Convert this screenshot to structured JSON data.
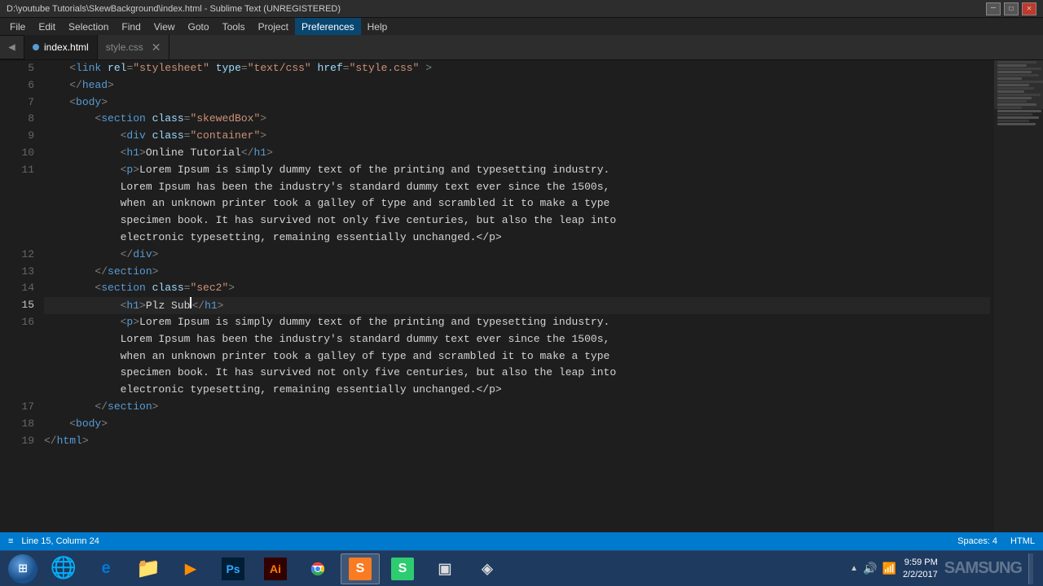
{
  "titleBar": {
    "text": "D:\\youtube Tutorials\\SkewBackground\\index.html - Sublime Text (UNREGISTERED)",
    "controls": [
      "—",
      "☐",
      "✕"
    ]
  },
  "menuBar": {
    "items": [
      "File",
      "Edit",
      "Selection",
      "Find",
      "View",
      "Goto",
      "Tools",
      "Project",
      "Preferences",
      "Help"
    ]
  },
  "tabs": [
    {
      "id": "index",
      "label": "index.html",
      "active": true,
      "modified": true
    },
    {
      "id": "style",
      "label": "style.css",
      "active": false,
      "modified": false,
      "closeable": true
    }
  ],
  "statusBar": {
    "line": "Line 15, Column 24",
    "spaces": "Spaces: 4",
    "encoding": "HTML"
  },
  "taskbar": {
    "apps": [
      {
        "name": "windows-start",
        "icon": "⊞"
      },
      {
        "name": "browser-ie",
        "icon": "🌐"
      },
      {
        "name": "browser-edge",
        "icon": "e"
      },
      {
        "name": "file-explorer",
        "icon": "📁"
      },
      {
        "name": "media-player",
        "icon": "▶"
      },
      {
        "name": "photoshop",
        "icon": "Ps"
      },
      {
        "name": "illustrator",
        "icon": "Ai"
      },
      {
        "name": "chrome",
        "icon": "◉"
      },
      {
        "name": "sublime-text",
        "icon": "S"
      },
      {
        "name": "app6",
        "icon": "S"
      },
      {
        "name": "app7",
        "icon": "▣"
      },
      {
        "name": "app8",
        "icon": "◈"
      }
    ],
    "clock": {
      "time": "9:59 PM",
      "date": "2/2/2017"
    }
  },
  "code": {
    "lines": [
      {
        "num": 5,
        "content": [
          {
            "t": "punct",
            "v": "    <"
          },
          {
            "t": "tag",
            "v": "link"
          },
          {
            "t": "attr",
            "v": " rel"
          },
          {
            "t": "punct",
            "v": "="
          },
          {
            "t": "str",
            "v": "\"stylesheet\""
          },
          {
            "t": "attr",
            "v": " type"
          },
          {
            "t": "punct",
            "v": "="
          },
          {
            "t": "str",
            "v": "\"text/css\""
          },
          {
            "t": "attr",
            "v": " href"
          },
          {
            "t": "punct",
            "v": "="
          },
          {
            "t": "str",
            "v": "\"style.css\""
          },
          {
            "t": "punct",
            "v": " >"
          }
        ]
      },
      {
        "num": 6,
        "content": [
          {
            "t": "punct",
            "v": "    </"
          },
          {
            "t": "tag",
            "v": "head"
          },
          {
            "t": "punct",
            "v": ">"
          }
        ]
      },
      {
        "num": 7,
        "content": [
          {
            "t": "punct",
            "v": "    <"
          },
          {
            "t": "tag",
            "v": "body"
          },
          {
            "t": "punct",
            "v": ">"
          }
        ]
      },
      {
        "num": 8,
        "content": [
          {
            "t": "punct",
            "v": "        <"
          },
          {
            "t": "tag",
            "v": "section"
          },
          {
            "t": "attr",
            "v": " class"
          },
          {
            "t": "punct",
            "v": "="
          },
          {
            "t": "str",
            "v": "\"skewedBox\""
          },
          {
            "t": "punct",
            "v": ">"
          }
        ]
      },
      {
        "num": 9,
        "content": [
          {
            "t": "punct",
            "v": "            <"
          },
          {
            "t": "tag",
            "v": "div"
          },
          {
            "t": "attr",
            "v": " class"
          },
          {
            "t": "punct",
            "v": "="
          },
          {
            "t": "str",
            "v": "\"container\""
          },
          {
            "t": "punct",
            "v": ">"
          }
        ]
      },
      {
        "num": 10,
        "content": [
          {
            "t": "punct",
            "v": "            <"
          },
          {
            "t": "tag",
            "v": "h1"
          },
          {
            "t": "punct",
            "v": ">"
          },
          {
            "t": "text",
            "v": "Online Tutorial"
          },
          {
            "t": "punct",
            "v": "</"
          },
          {
            "t": "tag",
            "v": "h1"
          },
          {
            "t": "punct",
            "v": ">"
          }
        ]
      },
      {
        "num": 11,
        "content": [
          {
            "t": "punct",
            "v": "            <"
          },
          {
            "t": "tag",
            "v": "p"
          },
          {
            "t": "punct",
            "v": ">"
          },
          {
            "t": "text",
            "v": "Lorem Ipsum is simply dummy text of the printing and typesetting industry."
          },
          {
            "t": "punct",
            "v": ""
          }
        ]
      },
      {
        "num": "",
        "content": [
          {
            "t": "text",
            "v": "            Lorem Ipsum has been the industry's standard dummy text ever since the 1500s,"
          }
        ]
      },
      {
        "num": "",
        "content": [
          {
            "t": "text",
            "v": "            when an unknown printer took a galley of type and scrambled it to make a type"
          }
        ]
      },
      {
        "num": "",
        "content": [
          {
            "t": "text",
            "v": "            specimen book. It has survived not only five centuries, but also the leap into"
          }
        ]
      },
      {
        "num": "",
        "content": [
          {
            "t": "text",
            "v": "            electronic typesetting, remaining essentially unchanged.</p>"
          }
        ]
      },
      {
        "num": 12,
        "content": [
          {
            "t": "punct",
            "v": "            </"
          },
          {
            "t": "tag",
            "v": "div"
          },
          {
            "t": "punct",
            "v": ">"
          }
        ]
      },
      {
        "num": 13,
        "content": [
          {
            "t": "punct",
            "v": "        </"
          },
          {
            "t": "tag",
            "v": "section"
          },
          {
            "t": "punct",
            "v": ">"
          }
        ]
      },
      {
        "num": 14,
        "content": [
          {
            "t": "punct",
            "v": "        <"
          },
          {
            "t": "tag",
            "v": "section"
          },
          {
            "t": "attr",
            "v": " class"
          },
          {
            "t": "punct",
            "v": "="
          },
          {
            "t": "str",
            "v": "\"sec2\""
          },
          {
            "t": "punct",
            "v": ">"
          }
        ]
      },
      {
        "num": 15,
        "content": [
          {
            "t": "punct",
            "v": "            <"
          },
          {
            "t": "tag",
            "v": "h1"
          },
          {
            "t": "punct",
            "v": ">"
          },
          {
            "t": "text",
            "v": "Plz Sub"
          },
          {
            "t": "cursor",
            "v": ""
          },
          {
            "t": "punct",
            "v": "</"
          },
          {
            "t": "tag",
            "v": "h1"
          },
          {
            "t": "punct",
            "v": ">"
          }
        ],
        "current": true
      },
      {
        "num": 16,
        "content": [
          {
            "t": "punct",
            "v": "            <"
          },
          {
            "t": "tag",
            "v": "p"
          },
          {
            "t": "punct",
            "v": ">"
          },
          {
            "t": "text",
            "v": "Lorem Ipsum is simply dummy text of the printing and typesetting industry."
          }
        ]
      },
      {
        "num": "",
        "content": [
          {
            "t": "text",
            "v": "            Lorem Ipsum has been the industry's standard dummy text ever since the 1500s,"
          }
        ]
      },
      {
        "num": "",
        "content": [
          {
            "t": "text",
            "v": "            when an unknown printer took a galley of type and scrambled it to make a type"
          }
        ]
      },
      {
        "num": "",
        "content": [
          {
            "t": "text",
            "v": "            specimen book. It has survived not only five centuries, but also the leap into"
          }
        ]
      },
      {
        "num": "",
        "content": [
          {
            "t": "text",
            "v": "            electronic typesetting, remaining essentially unchanged.</p>"
          }
        ]
      },
      {
        "num": 17,
        "content": [
          {
            "t": "punct",
            "v": "        </"
          },
          {
            "t": "tag",
            "v": "section"
          },
          {
            "t": "punct",
            "v": ">"
          }
        ]
      },
      {
        "num": 18,
        "content": [
          {
            "t": "punct",
            "v": "    <"
          },
          {
            "t": "tag",
            "v": "body"
          },
          {
            "t": "punct",
            "v": ">"
          }
        ]
      },
      {
        "num": 19,
        "content": [
          {
            "t": "punct",
            "v": "</"
          },
          {
            "t": "tag",
            "v": "html"
          },
          {
            "t": "punct",
            "v": ">"
          }
        ]
      }
    ]
  }
}
